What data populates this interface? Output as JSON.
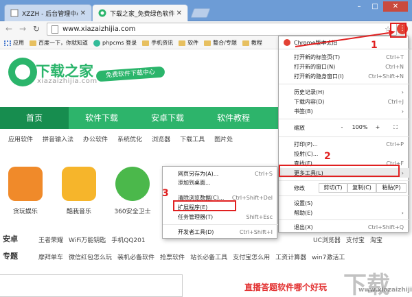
{
  "tabs": [
    {
      "title": "XZZH - 后台管理中心"
    },
    {
      "title": "下载之家_免费绿色软件"
    }
  ],
  "address": {
    "url": "www.xiazaizhijia.com"
  },
  "bookmarks": [
    "应用",
    "百度一下，你就知道",
    "phpcms 登录",
    "手机资讯",
    "软件",
    "整合/专题",
    "教程"
  ],
  "site": {
    "logo_text": "下载之家",
    "logo_domain": "xiazaizhijia.com",
    "slogan": "免费软件下载中心",
    "main_nav": [
      "首页",
      "软件下载",
      "安卓下载",
      "软件教程"
    ],
    "sub_nav": [
      "应用软件",
      "拼音输入法",
      "办公软件",
      "系统优化",
      "浏览器",
      "下载工具",
      "图片处"
    ],
    "apps": [
      {
        "name": "贪玩娱乐",
        "color": "#f08a2a"
      },
      {
        "name": "酷我音乐",
        "color": "#f6b52b"
      },
      {
        "name": "360安全卫士",
        "color": "#4bb84b"
      }
    ],
    "rows": [
      {
        "label": "安卓",
        "links": [
          "王者荣耀",
          "WiFi万能钥匙",
          "手机QQ201",
          "",
          "",
          "",
          "UC浏览器",
          "支付宝",
          "淘宝"
        ]
      },
      {
        "label": "专题",
        "links": [
          "摩拜单车",
          "微信红包怎么玩",
          "装机必备软件",
          "抢票软件",
          "站长必备工具",
          "支付宝怎么用",
          "工资计算器",
          "win7激活工"
        ]
      }
    ],
    "bottom_caption": "直播答题软件哪个好玩",
    "watermark": "下载",
    "watermark_url": "www.xiazaizhijia.com"
  },
  "chrome_menu": {
    "update": "Chrome版本太旧",
    "new_tab": {
      "label": "打开新的标签页(T)",
      "shortcut": "Ctrl+T"
    },
    "new_window": {
      "label": "打开新的窗口(N)",
      "shortcut": "Ctrl+N"
    },
    "incognito": {
      "label": "打开新的隐身窗口(I)",
      "shortcut": "Ctrl+Shift+N"
    },
    "history": "历史记录(H)",
    "downloads": {
      "label": "下载内容(D)",
      "shortcut": "Ctrl+J"
    },
    "bookmarks": "书签(B)",
    "zoom": {
      "label": "缩放",
      "minus": "-",
      "value": "100%",
      "plus": "+",
      "fullscreen": "⛶"
    },
    "print": {
      "label": "打印(P)...",
      "shortcut": "Ctrl+P"
    },
    "cast": "投射(C)...",
    "find": {
      "label": "查找(F)...",
      "shortcut": "Ctrl+F"
    },
    "more_tools": "更多工具(L)",
    "edit": {
      "label": "修改",
      "cut": "剪切(T)",
      "copy": "复制(C)",
      "paste": "粘贴(P)"
    },
    "settings": "设置(S)",
    "help": "帮助(E)",
    "exit": {
      "label": "退出(X)",
      "shortcut": "Ctrl+Shift+Q"
    }
  },
  "more_tools_menu": [
    {
      "label": "网页另存为(A)...",
      "shortcut": "Ctrl+S"
    },
    {
      "label": "添加到桌面...",
      "shortcut": ""
    },
    {
      "label": "清除浏览数据(C)...",
      "shortcut": "Ctrl+Shift+Del"
    },
    {
      "label": "扩展程序(E)",
      "shortcut": ""
    },
    {
      "label": "任务管理器(T)",
      "shortcut": "Shift+Esc"
    },
    {
      "label": "开发者工具(D)",
      "shortcut": "Ctrl+Shift+I"
    }
  ],
  "annotations": {
    "step1": "1",
    "step2": "2",
    "step3": "3",
    "color": "#e02020"
  }
}
